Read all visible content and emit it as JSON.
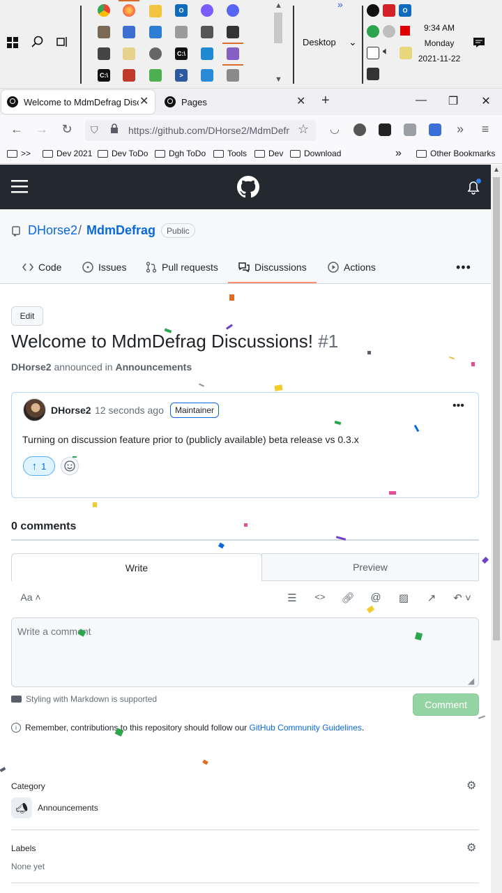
{
  "taskbar": {
    "desktop_label": "Desktop",
    "chevrons": "»",
    "clock": {
      "time": "9:34 AM",
      "day": "Monday",
      "date": "2021-11-22"
    }
  },
  "browser": {
    "tabs": [
      {
        "title": "Welcome to MdmDefrag Discus",
        "active": true
      },
      {
        "title": "Pages",
        "active": false
      }
    ],
    "url": "https://github.com/DHorse2/MdmDefr",
    "bookmarks": [
      ">>",
      "Dev 2021",
      "Dev ToDo",
      "Dgh ToDo",
      "Tools",
      "Dev",
      "Download"
    ],
    "other_bookmarks": "Other Bookmarks"
  },
  "repo": {
    "owner": "DHorse2",
    "separator": "/",
    "name": "MdmDefrag",
    "visibility": "Public",
    "tabs": [
      "Code",
      "Issues",
      "Pull requests",
      "Discussions",
      "Actions"
    ],
    "active_tab": "Discussions"
  },
  "discussion": {
    "edit_label": "Edit",
    "title": "Welcome to MdmDefrag Discussions!",
    "number": "#1",
    "author": "DHorse2",
    "announced_in": "announced in",
    "category": "Announcements",
    "post": {
      "author": "DHorse2",
      "time": "12 seconds ago",
      "role_badge": "Maintainer",
      "body": "Turning on discussion feature prior to (publicly available) beta release vs 0.3.x",
      "upvotes": "1"
    }
  },
  "comments": {
    "count_label": "0 comments",
    "write_tab": "Write",
    "preview_tab": "Preview",
    "text_size_label": "Aa",
    "placeholder": "Write a comment",
    "markdown_note": "Styling with Markdown is supported",
    "submit_label": "Comment",
    "guidelines_prefix": "Remember, contributions to this repository should follow our",
    "guidelines_link": "GitHub Community Guidelines",
    "guidelines_suffix": "."
  },
  "sidebar": {
    "category_label": "Category",
    "category_value": "Announcements",
    "labels_label": "Labels",
    "labels_value": "None yet"
  },
  "colors": {
    "github_header": "#24292f",
    "link_blue": "#0969da",
    "active_tab_underline": "#fd8c73",
    "comment_button_disabled": "#94d3a2"
  }
}
